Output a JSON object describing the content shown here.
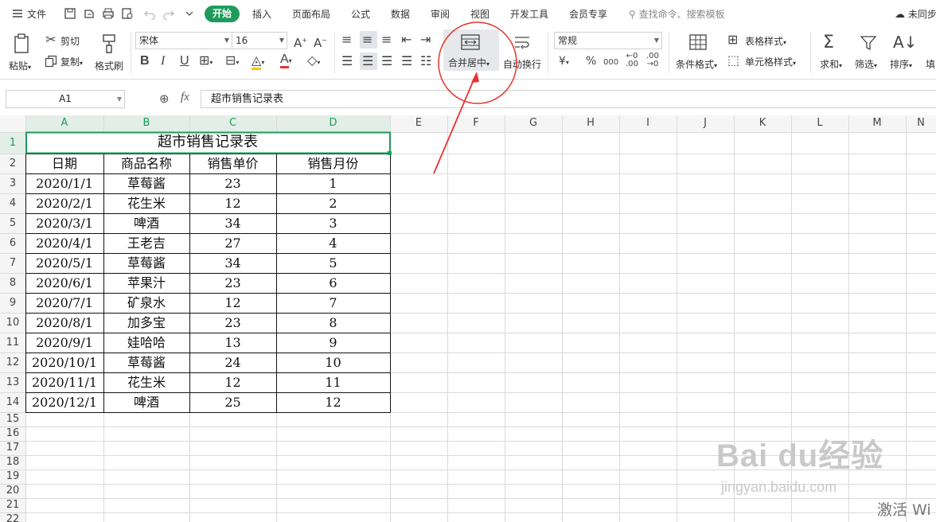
{
  "menu": {
    "file": "文件",
    "tabs": [
      "开始",
      "插入",
      "页面布局",
      "公式",
      "数据",
      "审阅",
      "视图",
      "开发工具",
      "会员专享"
    ],
    "search": "查找命令、搜索模板",
    "sync": "未同步"
  },
  "ribbon": {
    "paste": "粘贴",
    "cut": "剪切",
    "copy": "复制",
    "format_painter": "格式刷",
    "font_name": "宋体",
    "font_size": "16",
    "bold": "B",
    "italic": "I",
    "underline": "U",
    "merge_center": "合并居中",
    "wrap_text": "自动换行",
    "number_format": "常规",
    "currency_symbol": "¥",
    "percent_symbol": "%",
    "thousands_symbol": "000",
    "cond_format": "条件格式",
    "table_style": "表格样式",
    "cell_style": "单元格样式",
    "sum": "求和",
    "filter": "筛选",
    "sort": "排序",
    "fill": "填"
  },
  "formula_bar": {
    "cell_ref": "A1",
    "fx": "fx",
    "content": "超市销售记录表"
  },
  "sheet": {
    "columns": [
      "A",
      "B",
      "C",
      "D",
      "E",
      "F",
      "G",
      "H",
      "I",
      "J",
      "K",
      "L",
      "M",
      "N"
    ],
    "row_numbers": [
      "1",
      "2",
      "3",
      "4",
      "5",
      "6",
      "7",
      "8",
      "9",
      "10",
      "11",
      "12",
      "13",
      "14",
      "15",
      "16",
      "17",
      "18",
      "19",
      "20",
      "21",
      "22"
    ],
    "title": "超市销售记录表",
    "headers": [
      "日期",
      "商品名称",
      "销售单价",
      "销售月份"
    ],
    "rows": [
      [
        "2020/1/1",
        "草莓酱",
        "23",
        "1"
      ],
      [
        "2020/2/1",
        "花生米",
        "12",
        "2"
      ],
      [
        "2020/3/1",
        "啤酒",
        "34",
        "3"
      ],
      [
        "2020/4/1",
        "王老吉",
        "27",
        "4"
      ],
      [
        "2020/5/1",
        "草莓酱",
        "34",
        "5"
      ],
      [
        "2020/6/1",
        "苹果汁",
        "23",
        "6"
      ],
      [
        "2020/7/1",
        "矿泉水",
        "12",
        "7"
      ],
      [
        "2020/8/1",
        "加多宝",
        "23",
        "8"
      ],
      [
        "2020/9/1",
        "娃哈哈",
        "13",
        "9"
      ],
      [
        "2020/10/1",
        "草莓酱",
        "24",
        "10"
      ],
      [
        "2020/11/1",
        "花生米",
        "12",
        "11"
      ],
      [
        "2020/12/1",
        "啤酒",
        "25",
        "12"
      ]
    ]
  },
  "watermark": {
    "main": "Bai du经验",
    "sub": "jingyan.baidu.com"
  },
  "activate_text": "激活 Wi",
  "colors": {
    "accent_green": "#1e9b5b",
    "selection_green": "#1e9b5b",
    "annotation_red": "#e8322f",
    "grid_line": "#dadada"
  }
}
